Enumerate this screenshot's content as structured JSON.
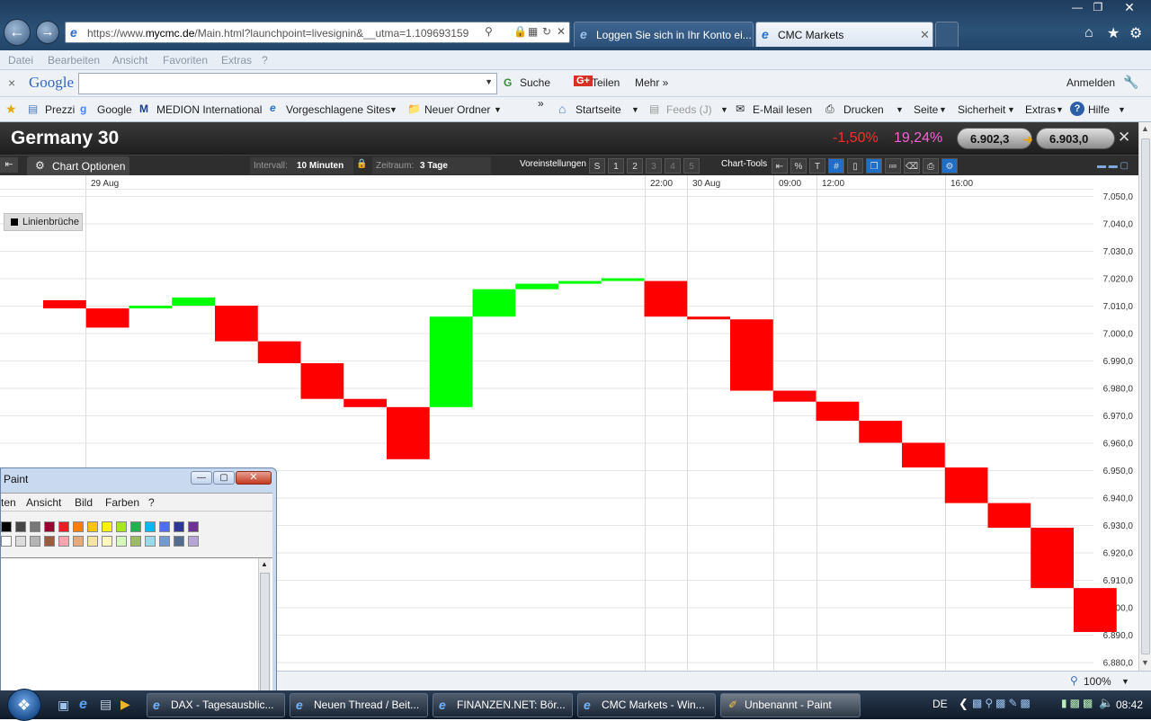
{
  "browser": {
    "url_prefix": "https://www.",
    "url_domain": "mycmc.de",
    "url_rest": "/Main.html?launchpoint=livesignin&__utma=1.109693159",
    "tabs": [
      {
        "label": "Loggen Sie sich in Ihr Konto ei..."
      },
      {
        "label": "CMC Markets"
      }
    ],
    "menu": [
      "Datei",
      "Bearbeiten",
      "Ansicht",
      "Favoriten",
      "Extras",
      "?"
    ],
    "google_bar": {
      "close": "×",
      "logo": "Google",
      "search": "Suche",
      "share": "Teilen",
      "more": "Mehr »",
      "signin": "Anmelden"
    },
    "favorites": [
      "Prezzi",
      "Google",
      "MEDION International",
      "Vorgeschlagene Sites",
      "Neuer Ordner"
    ],
    "commands": [
      "Startseite",
      "Feeds (J)",
      "E-Mail lesen",
      "Drucken",
      "Seite",
      "Sicherheit",
      "Extras",
      "Hilfe"
    ],
    "zoom": "100%"
  },
  "cmc": {
    "instrument": "Germany 30",
    "change_pct": "-1,50%",
    "vol_pct": "19,24%",
    "bid": "6.902,3",
    "ask": "6.903,0",
    "chart_options": "Chart Optionen",
    "interval_label": "Intervall:",
    "interval_value": "10 Minuten",
    "range_label": "Zeitraum:",
    "range_value": "3 Tage",
    "presets_label": "Voreinstellungen",
    "presets": [
      "S",
      "1",
      "2",
      "3",
      "4",
      "5"
    ],
    "chart_tools": "Chart-Tools",
    "legend": "Linienbrüche",
    "colors": {
      "up": "#00ff00",
      "down": "#ff0000",
      "header_bg": "#2a2a2a"
    }
  },
  "chart_data": {
    "type": "bar",
    "subtype": "three-line-break",
    "x_labels": [
      "29 Aug",
      "22:00",
      "30 Aug",
      "09:00",
      "12:00",
      "16:00"
    ],
    "y_ticks": [
      "7.050,0",
      "7.040,0",
      "7.030,0",
      "7.020,0",
      "7.010,0",
      "7.000,0",
      "6.990,0",
      "6.980,0",
      "6.970,0",
      "6.960,0",
      "6.950,0",
      "6.940,0",
      "6.930,0",
      "6.920,0",
      "6.910,0",
      "6.900,0",
      "6.890,0",
      "6.880,0"
    ],
    "ylim": [
      6875,
      7055
    ],
    "grid": true,
    "bricks": [
      {
        "dir": "down",
        "open": 7012,
        "close": 7009
      },
      {
        "dir": "down",
        "open": 7009,
        "close": 7002
      },
      {
        "dir": "up",
        "open": 7009,
        "close": 7010
      },
      {
        "dir": "up",
        "open": 7010,
        "close": 7013
      },
      {
        "dir": "down",
        "open": 7010,
        "close": 6997
      },
      {
        "dir": "down",
        "open": 6997,
        "close": 6989
      },
      {
        "dir": "down",
        "open": 6989,
        "close": 6976
      },
      {
        "dir": "down",
        "open": 6976,
        "close": 6973
      },
      {
        "dir": "down",
        "open": 6973,
        "close": 6954
      },
      {
        "dir": "up",
        "open": 6973,
        "close": 7006
      },
      {
        "dir": "up",
        "open": 7006,
        "close": 7016
      },
      {
        "dir": "up",
        "open": 7016,
        "close": 7018
      },
      {
        "dir": "up",
        "open": 7018,
        "close": 7019
      },
      {
        "dir": "up",
        "open": 7019,
        "close": 7020
      },
      {
        "dir": "down",
        "open": 7019,
        "close": 7006
      },
      {
        "dir": "down",
        "open": 7006,
        "close": 7005
      },
      {
        "dir": "down",
        "open": 7005,
        "close": 6979
      },
      {
        "dir": "down",
        "open": 6979,
        "close": 6975
      },
      {
        "dir": "down",
        "open": 6975,
        "close": 6968
      },
      {
        "dir": "down",
        "open": 6968,
        "close": 6960
      },
      {
        "dir": "down",
        "open": 6960,
        "close": 6951
      },
      {
        "dir": "down",
        "open": 6951,
        "close": 6938
      },
      {
        "dir": "down",
        "open": 6938,
        "close": 6929
      },
      {
        "dir": "down",
        "open": 6929,
        "close": 6907
      },
      {
        "dir": "down",
        "open": 6907,
        "close": 6891
      }
    ]
  },
  "paint": {
    "title": "Paint",
    "menu": [
      "ten",
      "Ansicht",
      "Bild",
      "Farben",
      "?"
    ],
    "palette_top": [
      "#000000",
      "#464646",
      "#787878",
      "#990030",
      "#ed1c24",
      "#ff7e00",
      "#ffc20e",
      "#fff200",
      "#a8e61d",
      "#22b14c",
      "#00b7ef",
      "#4d6df3",
      "#2f3699",
      "#6f3198"
    ],
    "palette_bottom": [
      "#ffffff",
      "#dcdcdc",
      "#b4b4b4",
      "#9c5a3c",
      "#ffa3b1",
      "#e5aa7a",
      "#f5e49c",
      "#fff9bd",
      "#d3f9bc",
      "#9dbb61",
      "#99d9ea",
      "#709ad1",
      "#546d8e",
      "#b5a5d5"
    ]
  },
  "taskbar": {
    "tasks": [
      "DAX - Tagesausblic...",
      "Neuen Thread / Beit...",
      "FINANZEN.NET: Bör...",
      "CMC Markets - Win...",
      "Unbenannt - Paint"
    ],
    "lang": "DE",
    "time": "08:42"
  }
}
